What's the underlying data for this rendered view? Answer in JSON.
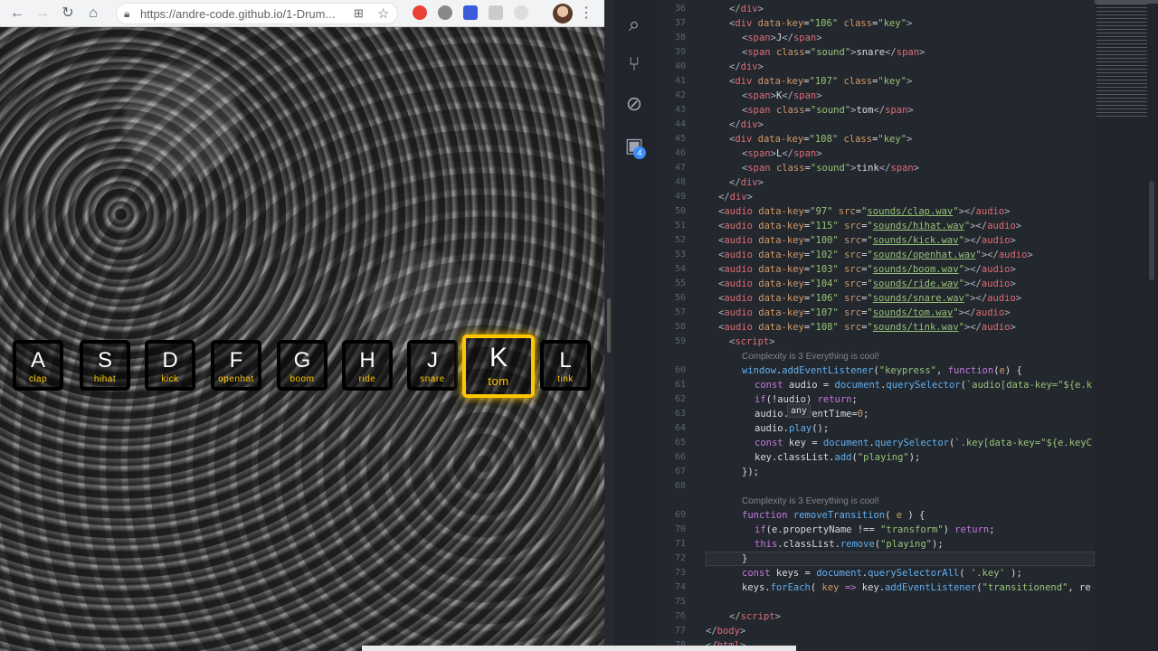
{
  "browser": {
    "url": "https://andre-code.github.io/1-Drum...",
    "nav": {
      "back": "←",
      "forward": "→",
      "reload": "↻",
      "home": "⌂"
    },
    "menu": "⋮"
  },
  "drum_kit": {
    "keys": [
      {
        "letter": "A",
        "sound": "clap"
      },
      {
        "letter": "S",
        "sound": "hihat"
      },
      {
        "letter": "D",
        "sound": "kick"
      },
      {
        "letter": "F",
        "sound": "openhat"
      },
      {
        "letter": "G",
        "sound": "boom"
      },
      {
        "letter": "H",
        "sound": "ride"
      },
      {
        "letter": "J",
        "sound": "snare"
      },
      {
        "letter": "K",
        "sound": "tom",
        "playing": true
      },
      {
        "letter": "L",
        "sound": "tink"
      }
    ],
    "accent_color": "#ffc600"
  },
  "activity_bar": {
    "icons": [
      "search-icon",
      "source-control-icon",
      "debug-icon",
      "extensions-icon"
    ],
    "badge": "4"
  },
  "editor": {
    "tooltip": "any",
    "hint_60": "Complexity is 3 Everything is cool!",
    "hint_69": "Complexity is 3 Everything is cool!"
  }
}
